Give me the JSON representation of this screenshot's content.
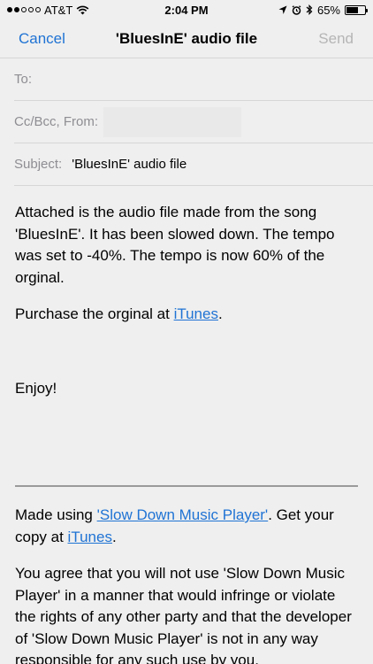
{
  "status_bar": {
    "carrier": "AT&T",
    "time": "2:04 PM",
    "battery": "65%",
    "battery_level": 0.65,
    "signal_bars": 2,
    "icons": [
      "wifi-icon",
      "location-icon",
      "alarm-icon",
      "bluetooth-icon",
      "battery-icon"
    ]
  },
  "nav": {
    "cancel_label": "Cancel",
    "title": "'BluesInE' audio file",
    "send_label": "Send"
  },
  "fields": {
    "to_label": "To:",
    "cc_label": "Cc/Bcc, From:",
    "subject_label": "Subject:",
    "subject_value": "'BluesInE' audio file"
  },
  "body": {
    "p1": "Attached is the audio file made from the song 'BluesInE'. It has been slowed down. The tempo was set to -40%. The tempo is now 60% of the orginal.",
    "p2_prefix": "Purchase the orginal at ",
    "p2_link": "iTunes",
    "p2_suffix": ".",
    "p3": "Enjoy!",
    "p4_prefix": "Made using ",
    "p4_link1": "'Slow Down Music Player'",
    "p4_mid": ". Get your copy at ",
    "p4_link2": "iTunes",
    "p4_suffix": ".",
    "p5": "You agree that you will not use 'Slow Down Music Player' in a manner that would infringe or violate the rights of any other party and that the developer of 'Slow Down Music Player' is not in any way responsible for any such use by you."
  },
  "colors": {
    "accent": "#1f73d4",
    "disabled": "#b5b5b5",
    "label_gray": "#8e8e93",
    "background": "#efefef"
  }
}
